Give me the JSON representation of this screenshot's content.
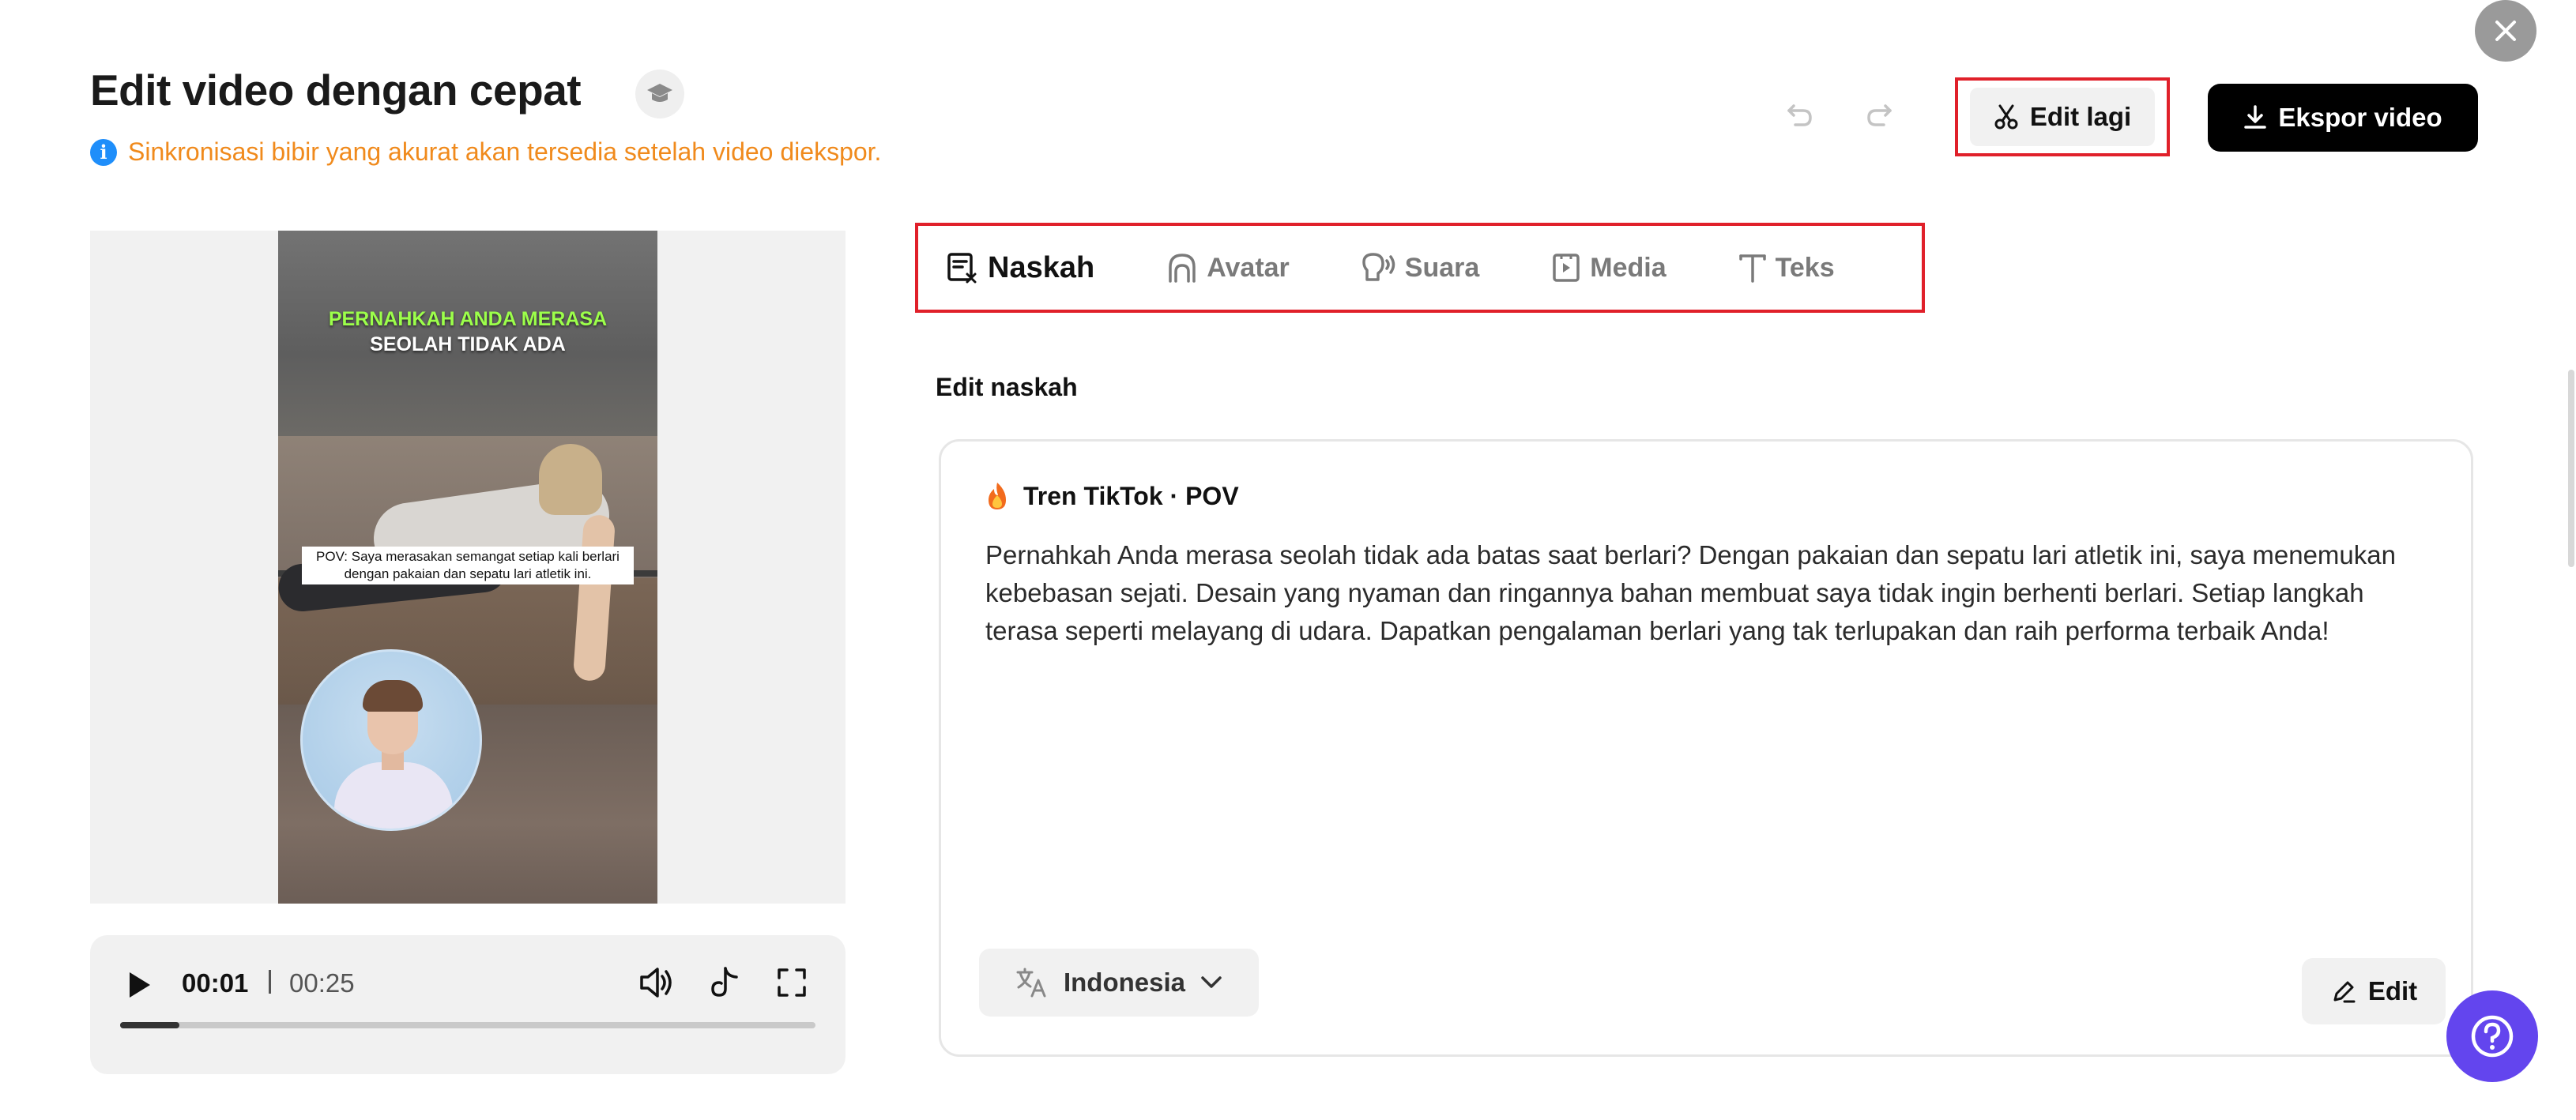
{
  "header": {
    "title": "Edit video dengan cepat",
    "info_text": "Sinkronisasi bibir yang akurat akan tersedia setelah video diekspor."
  },
  "actions": {
    "edit_again_label": "Edit lagi",
    "export_label": "Ekspor video"
  },
  "video": {
    "headline_green": "PERNAHKAH ANDA MERASA",
    "headline_white": "SEOLAH TIDAK ADA",
    "caption": "POV: Saya merasakan semangat setiap kali berlari dengan pakaian dan sepatu lari atletik ini."
  },
  "player": {
    "current_time": "00:01",
    "total_time": "00:25",
    "progress": 0.04
  },
  "tabs": [
    {
      "label": "Naskah",
      "active": true
    },
    {
      "label": "Avatar",
      "active": false
    },
    {
      "label": "Suara",
      "active": false
    },
    {
      "label": "Media",
      "active": false
    },
    {
      "label": "Teks",
      "active": false
    }
  ],
  "script": {
    "section_label": "Edit naskah",
    "template_name": "Tren TikTok · POV",
    "body": "Pernahkah Anda merasa seolah tidak ada batas saat berlari? Dengan pakaian dan sepatu lari atletik ini, saya menemukan kebebasan sejati. Desain yang nyaman dan ringannya bahan membuat saya tidak ingin berhenti berlari. Setiap langkah terasa seperti melayang di udara. Dapatkan pengalaman berlari yang tak terlupakan dan raih performa terbaik Anda!",
    "language": "Indonesia",
    "edit_label": "Edit"
  },
  "colors": {
    "accent_red": "#e0202a",
    "info_orange": "#f08a1c",
    "info_blue": "#1f8efa",
    "help_purple": "#6345ee"
  }
}
